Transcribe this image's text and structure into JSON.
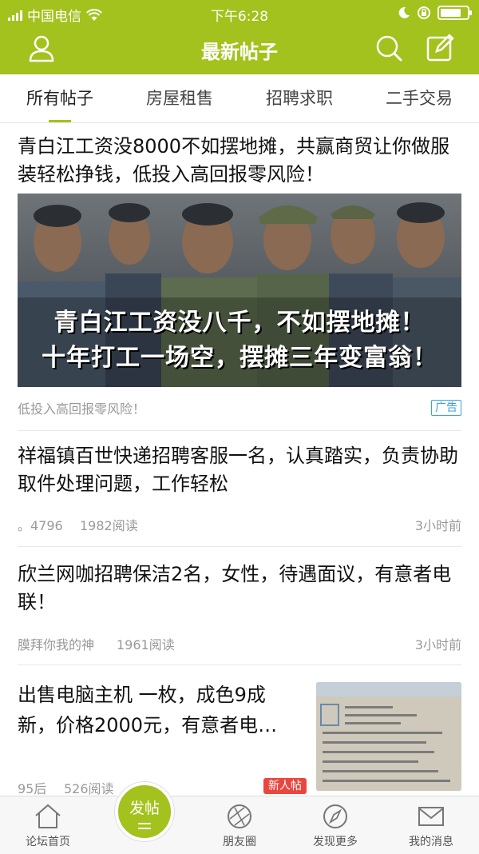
{
  "status_bar": {
    "carrier": "中国电信",
    "time": "下午6:28"
  },
  "header": {
    "title": "最新帖子"
  },
  "tabs": [
    {
      "label": "所有帖子",
      "active": true
    },
    {
      "label": "房屋租售",
      "active": false
    },
    {
      "label": "招聘求职",
      "active": false
    },
    {
      "label": "二手交易",
      "active": false
    }
  ],
  "ad_post": {
    "title": "青白江工资没8000不如摆地摊，共赢商贸让你做服装轻松挣钱，低投入高回报零风险！",
    "image_caption_1": "青白江工资没八千，不如摆地摊！",
    "image_caption_2": "十年打工一场空，摆摊三年变富翁！",
    "subtitle": "低投入高回报零风险！",
    "ad_tag": "广告"
  },
  "posts": [
    {
      "title": "祥福镇百世快递招聘客服一名，认真踏实，负责协助取件处理问题，工作轻松",
      "author": "。4796",
      "reads": "1982阅读",
      "time": "3小时前"
    },
    {
      "title": "欣兰网咖招聘保洁2名，女性，待遇面议，有意者电联！",
      "author": "膜拜你我的神",
      "reads": "1961阅读",
      "time": "3小时前"
    },
    {
      "title": "出售电脑主机 一枚，成色9成新，价格2000元，有意者电…",
      "author": "95后",
      "reads": "526阅读",
      "badge": "新人帖"
    }
  ],
  "bottom_nav": [
    {
      "label": "论坛首页",
      "icon": "home-icon"
    },
    {
      "label": "发帖",
      "icon": "compose-icon"
    },
    {
      "label": "朋友圈",
      "icon": "aperture-icon"
    },
    {
      "label": "发现更多",
      "icon": "compass-icon"
    },
    {
      "label": "我的消息",
      "icon": "mail-icon"
    }
  ],
  "colors": {
    "brand": "#a3c21d",
    "ad_tag": "#3aa0e3",
    "new_badge": "#e8473f"
  }
}
